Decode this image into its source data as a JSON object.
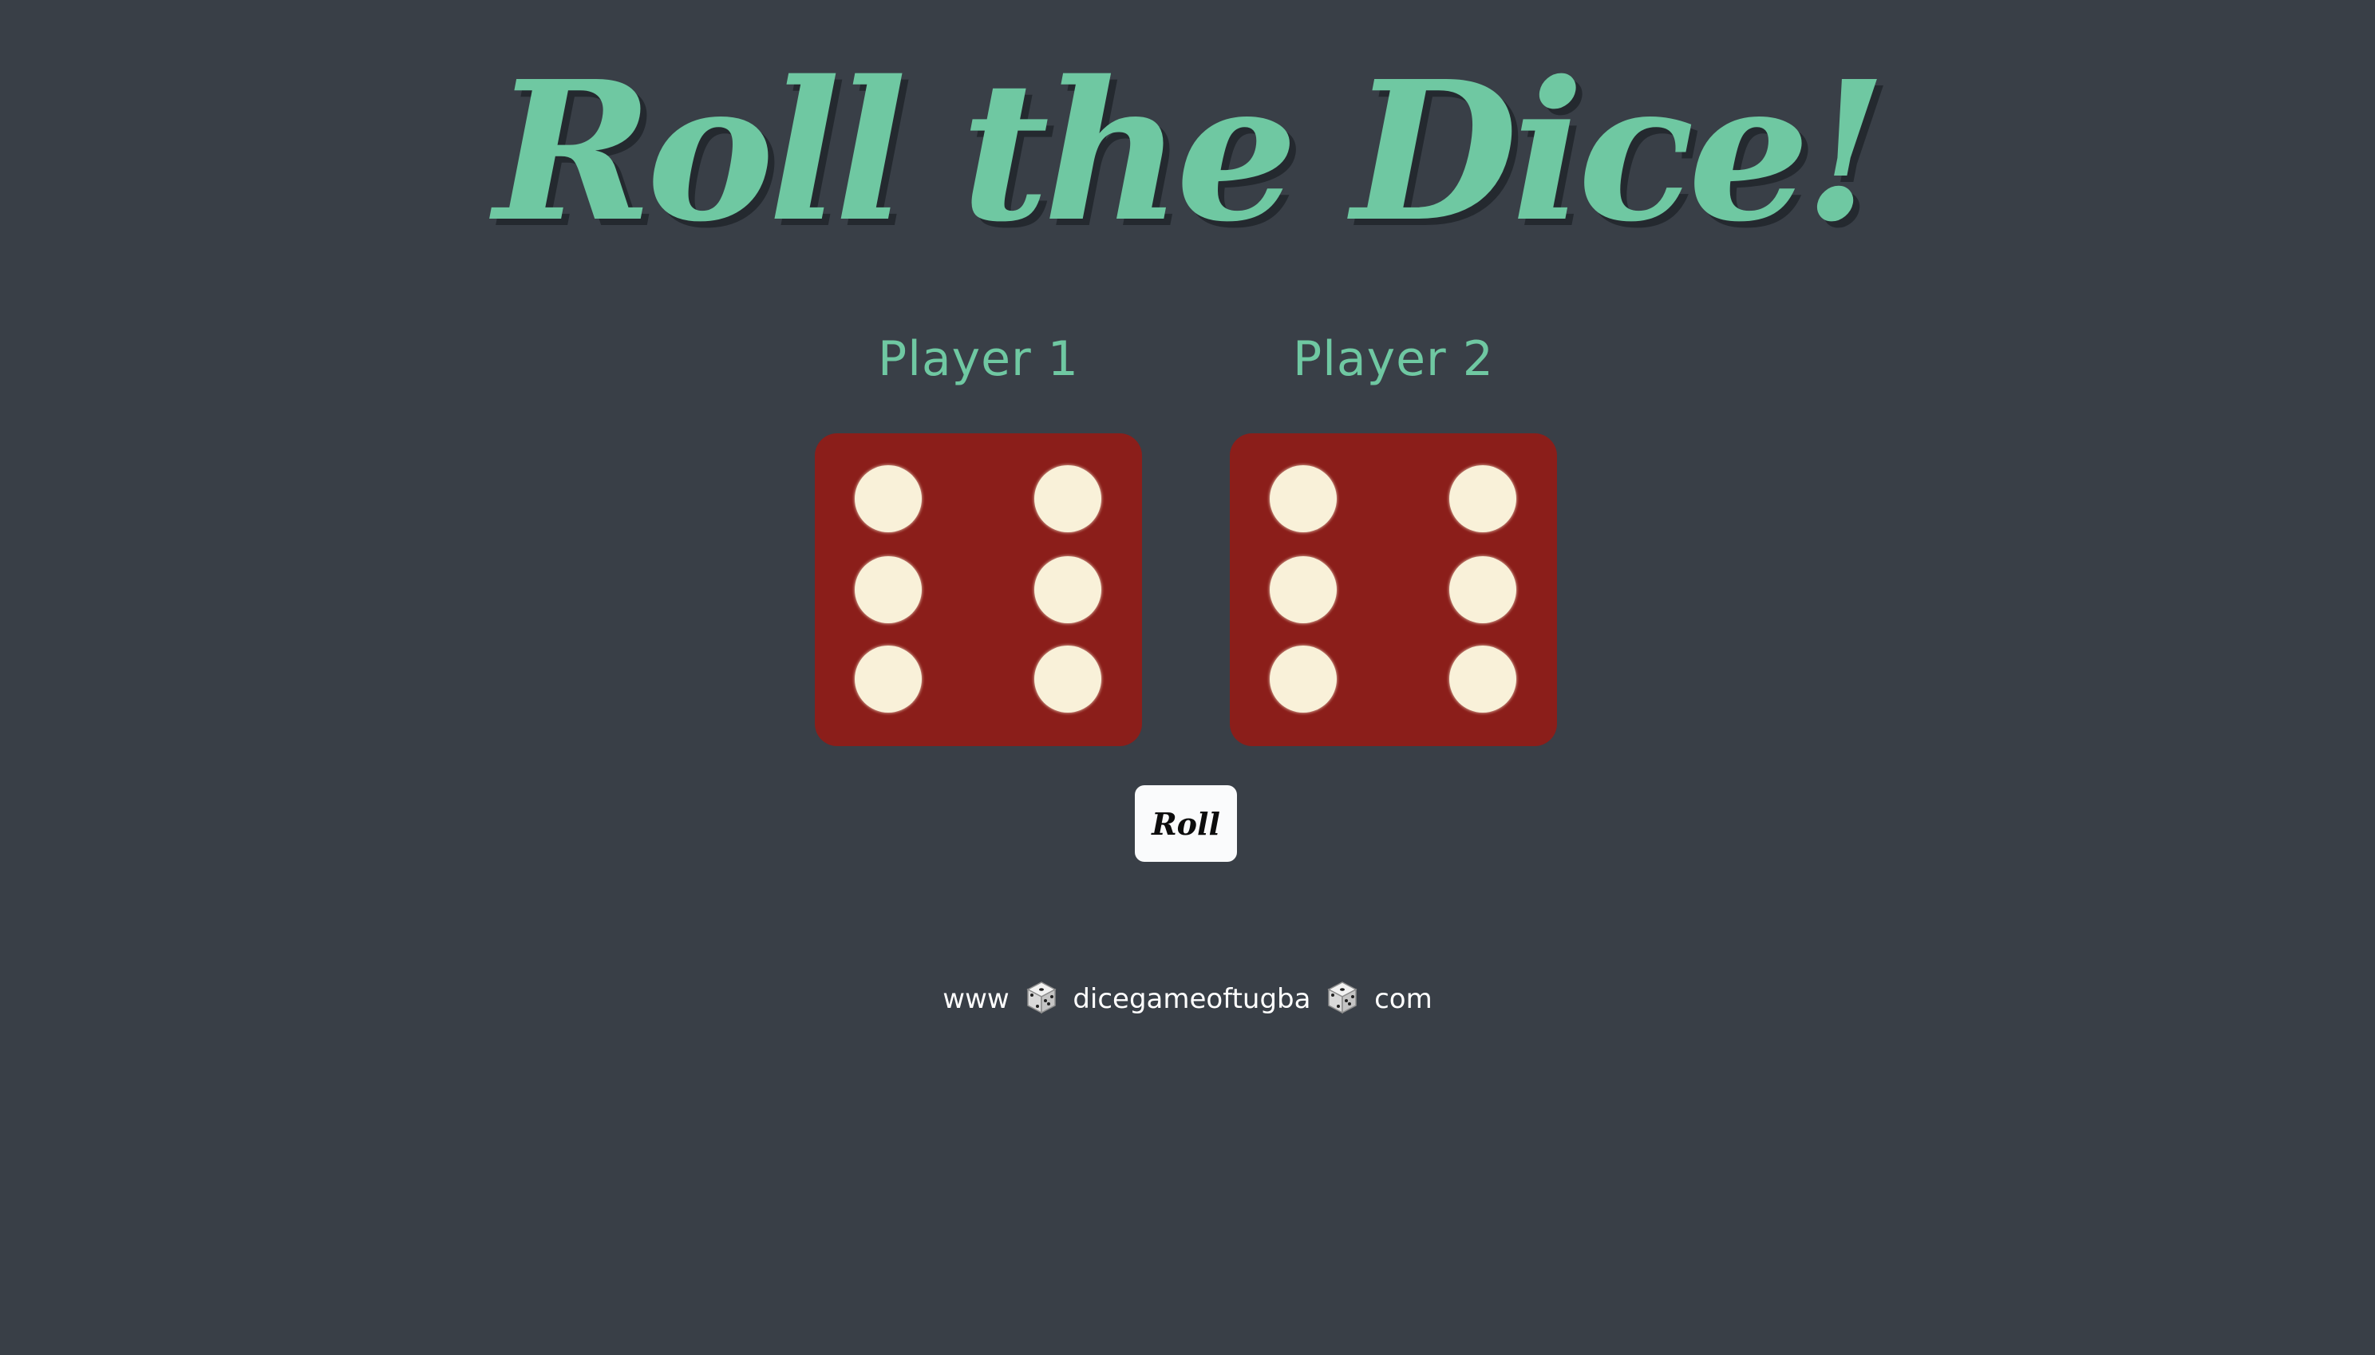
{
  "title": "Roll the Dice!",
  "players": [
    {
      "label": "Player 1",
      "die_value": 6
    },
    {
      "label": "Player 2",
      "die_value": 6
    }
  ],
  "roll_button_label": "Roll",
  "footer": {
    "prefix": "www",
    "domain": "dicegameoftugba",
    "suffix": "com",
    "separator_icon": "dice-icon"
  },
  "colors": {
    "background": "#393f47",
    "title_text": "#6fc8a2",
    "die_face": "#8b1e1a",
    "pip": "#f9f1d9",
    "button_background": "#fafbfc"
  }
}
